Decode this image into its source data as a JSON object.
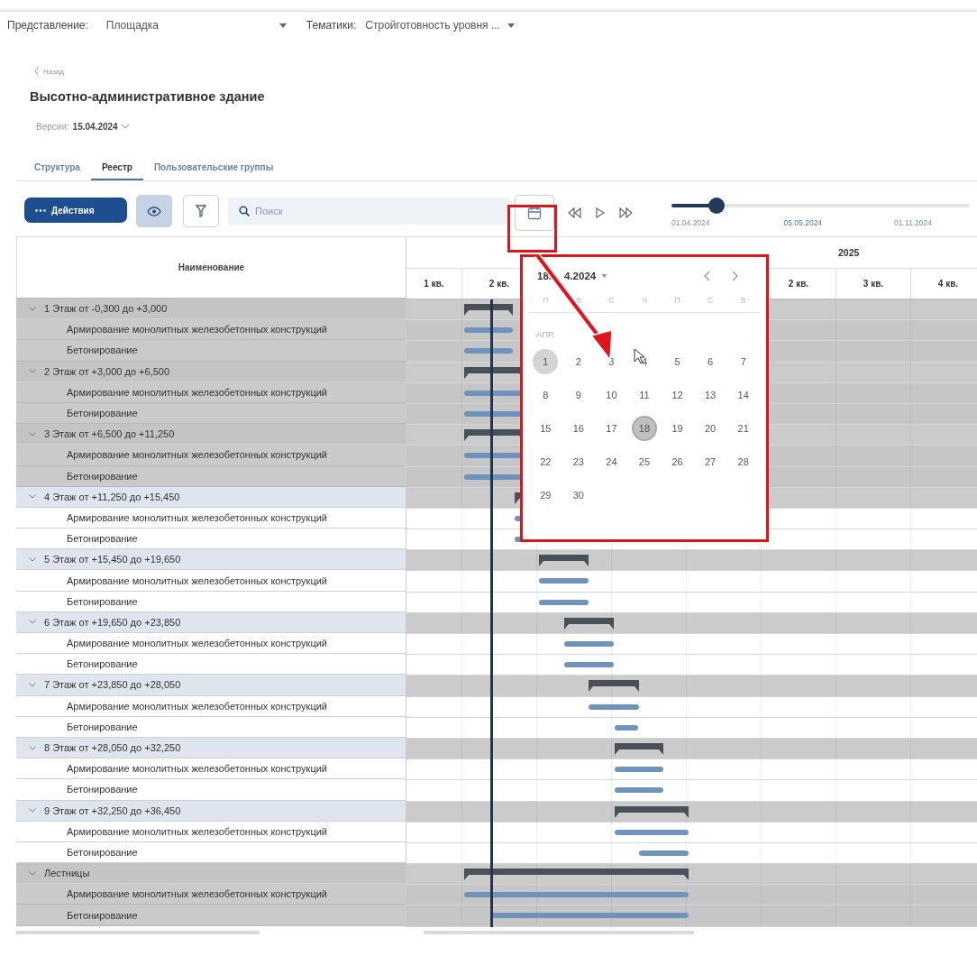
{
  "top_bar": {
    "view_label": "Представление:",
    "view_value": "Площадка",
    "topics_label": "Тематики:",
    "topics_value": "Стройготовность уровня ..."
  },
  "back_link": "Назад",
  "title": "Высотно-административное здание",
  "version": {
    "label": "Версия:",
    "value": "15.04.2024"
  },
  "tabs": [
    {
      "label": "Структура",
      "selected": false
    },
    {
      "label": "Реестр",
      "selected": true
    },
    {
      "label": "Пользовательские группы",
      "selected": false
    }
  ],
  "toolbar": {
    "actions_label": "Действия",
    "view_toggle_on": true,
    "search_placeholder": "Поиск"
  },
  "timeline": {
    "level": 0.15,
    "dates": [
      "01.04.2024",
      "05.05.2024",
      "01.11.2024"
    ]
  },
  "table": {
    "name_column": "Наименование",
    "year_2025": "2025",
    "quarters_2024": [
      "1 кв.",
      "2 кв."
    ],
    "quarters_2025": [
      "2 кв.",
      "3 кв.",
      "4 кв."
    ],
    "groups": [
      {
        "name": "1 Этаж от -0,300 до +3,000",
        "expanded": true,
        "highlighted": true,
        "children": [
          {
            "name": "Армирование монолитных железобетонных конструкций"
          },
          {
            "name": "Бетонирование"
          }
        ]
      },
      {
        "name": "2 Этаж от +3,000 до +6,500",
        "expanded": true,
        "highlighted": true,
        "children": [
          {
            "name": "Армирование монолитных железобетонных конструкций"
          },
          {
            "name": "Бетонирование"
          }
        ]
      },
      {
        "name": "3 Этаж от +6,500 до +11,250",
        "expanded": true,
        "highlighted": true,
        "children": [
          {
            "name": "Армирование монолитных железобетонных конструкций"
          },
          {
            "name": "Бетонирование"
          }
        ]
      },
      {
        "name": "4 Этаж от +11,250 до +15,450",
        "expanded": true,
        "highlighted": false,
        "children": [
          {
            "name": "Армирование монолитных железобетонных конструкций"
          },
          {
            "name": "Бетонирование"
          }
        ]
      },
      {
        "name": "5 Этаж от +15,450 до +19,650",
        "expanded": true,
        "highlighted": false,
        "children": [
          {
            "name": "Армирование монолитных железобетонных конструкций"
          },
          {
            "name": "Бетонирование"
          }
        ]
      },
      {
        "name": "6 Этаж от +19,650 до +23,850",
        "expanded": true,
        "highlighted": false,
        "children": [
          {
            "name": "Армирование монолитных железобетонных конструкций"
          },
          {
            "name": "Бетонирование"
          }
        ]
      },
      {
        "name": "7 Этаж от +23,850 до +28,050",
        "expanded": true,
        "highlighted": false,
        "children": [
          {
            "name": "Армирование монолитных железобетонных конструкций"
          },
          {
            "name": "Бетонирование"
          }
        ]
      },
      {
        "name": "8 Этаж от +28,050 до +32,250",
        "expanded": true,
        "highlighted": false,
        "children": [
          {
            "name": "Армирование монолитных железобетонных конструкций"
          },
          {
            "name": "Бетонирование"
          }
        ]
      },
      {
        "name": "9 Этаж от +32,250 до +36,450",
        "expanded": true,
        "highlighted": false,
        "children": [
          {
            "name": "Армирование монолитных железобетонных конструкций"
          },
          {
            "name": "Бетонирование"
          }
        ]
      },
      {
        "name": "Лестницы",
        "expanded": true,
        "highlighted": true,
        "children": [
          {
            "name": "Армирование монолитных железобетонных конструкций"
          },
          {
            "name": "Бетонирование"
          }
        ]
      }
    ]
  },
  "calendar": {
    "current": [
      "18.",
      "4.2024"
    ],
    "month": "АПР.",
    "weekdays": [
      "П",
      "В",
      "С",
      "Ч",
      "П",
      "С",
      "В"
    ],
    "days": [
      {
        "label": "1",
        "selected": false,
        "range_start": true
      },
      {
        "label": "2",
        "selected": false,
        "range_start": false
      },
      {
        "label": "3",
        "selected": false,
        "range_start": false
      },
      {
        "label": "4",
        "selected": false,
        "range_start": false
      },
      {
        "label": "5",
        "selected": false,
        "range_start": false
      },
      {
        "label": "6",
        "selected": false,
        "range_start": false
      },
      {
        "label": "7",
        "selected": false,
        "range_start": false
      },
      {
        "label": "8",
        "selected": false,
        "range_start": false
      },
      {
        "label": "9",
        "selected": false,
        "range_start": false
      },
      {
        "label": "10",
        "selected": false,
        "range_start": false
      },
      {
        "label": "11",
        "selected": false,
        "range_start": false
      },
      {
        "label": "12",
        "selected": false,
        "range_start": false
      },
      {
        "label": "13",
        "selected": false,
        "range_start": false
      },
      {
        "label": "14",
        "selected": false,
        "range_start": false
      },
      {
        "label": "15",
        "selected": false,
        "range_start": false
      },
      {
        "label": "16",
        "selected": false,
        "range_start": false
      },
      {
        "label": "17",
        "selected": false,
        "range_start": false
      },
      {
        "label": "18",
        "selected": true,
        "range_start": false
      },
      {
        "label": "19",
        "selected": false,
        "range_start": false
      },
      {
        "label": "20",
        "selected": false,
        "range_start": false
      },
      {
        "label": "21",
        "selected": false,
        "range_start": false
      },
      {
        "label": "22",
        "selected": false,
        "range_start": false
      },
      {
        "label": "23",
        "selected": false,
        "range_start": false
      },
      {
        "label": "24",
        "selected": false,
        "range_start": false
      },
      {
        "label": "25",
        "selected": false,
        "range_start": false
      },
      {
        "label": "26",
        "selected": false,
        "range_start": false
      },
      {
        "label": "27",
        "selected": false,
        "range_start": false
      },
      {
        "label": "28",
        "selected": false,
        "range_start": false
      },
      {
        "label": "29",
        "selected": false,
        "range_start": false
      },
      {
        "label": "30",
        "selected": false,
        "range_start": false
      }
    ]
  }
}
